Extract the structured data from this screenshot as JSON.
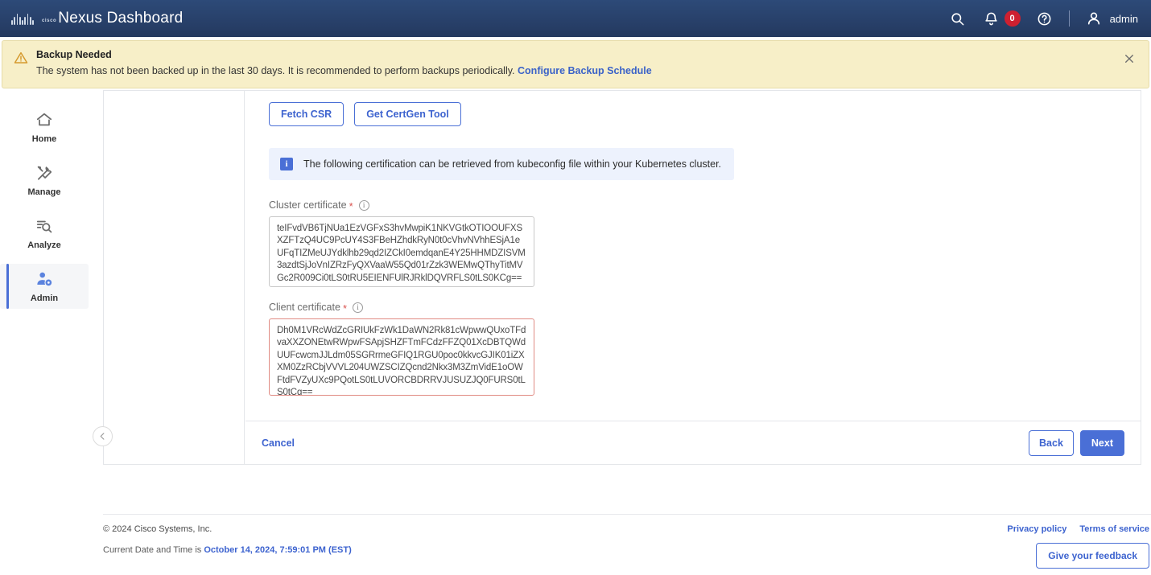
{
  "topbar": {
    "brand_title": "Nexus Dashboard",
    "logo_word": "cisco",
    "search_icon": "search-icon",
    "bell_icon": "bell-icon",
    "notification_count": "0",
    "help_icon": "help-circle-icon",
    "user_icon": "user-avatar-icon",
    "user_name": "admin"
  },
  "banner": {
    "icon": "warning-triangle-icon",
    "title": "Backup Needed",
    "message": "The system has not been backed up in the last 30 days. It is recommended to perform backups periodically.",
    "link_label": "Configure Backup Schedule",
    "close_icon": "close-icon",
    "background_color": "#f7efc8",
    "border_color": "#e6dca8"
  },
  "sidebar": {
    "items": [
      {
        "label": "Home",
        "icon": "home-icon",
        "active": false
      },
      {
        "label": "Manage",
        "icon": "tools-icon",
        "active": false
      },
      {
        "label": "Analyze",
        "icon": "magnifier-lines-icon",
        "active": false
      },
      {
        "label": "Admin",
        "icon": "user-gear-icon",
        "active": true
      }
    ],
    "active_accent_color": "#4a6fd6"
  },
  "main": {
    "buttons": {
      "fetch_csr": "Fetch CSR",
      "get_certgen_tool": "Get CertGen Tool"
    },
    "info_box": {
      "icon": "info-icon",
      "text": "The following certification can be retrieved from kubeconfig file within your Kubernetes cluster.",
      "background_color": "#edf2fd"
    },
    "cluster_certificate": {
      "label": "Cluster certificate",
      "required": "*",
      "info_icon": "info-circle-icon",
      "value": "teIFvdVB6TjNUa1EzVGFxS3hvMwpiK1NKVGtkOTIOOUFXSXZFTzQ4UC9PcUY4S3FBeHZhdkRyN0t0cVhvNVhhESjA1eUFqTIZMeUJYdklhb29qd2IZCkI0emdqanE4Y25HHMDZISVM3azdtSjJoVnIZRzFyQXVaaW55Qd01rZzk3WEMwQThyTitMVGc2R009Ci0tLS0tRU5EIENFUlRJRklDQVRFLS0tLS0KCg==",
      "state": "normal"
    },
    "client_certificate": {
      "label": "Client certificate",
      "required": "*",
      "info_icon": "info-circle-icon",
      "value": "Dh0M1VRcWdZcGRIUkFzWk1DaWN2Rk81cWpwwQUxoTFdvaXXZONEtwRWpwFSApjSHZFTmFCdzFFZQ01XcDBTQWdUUFcwcmJJLdm05SGRrmeGFIQ1RGU0poc0kkvcGJIK01iZXXM0ZzRCbjVVVL204UWZSCIZQcnd2Nkx3M3ZmVidE1oOWFtdFVZyUXc9PQotLS0tLUVORCBDRRVJUSUZJQ0FURS0tLS0tCg==",
      "state": "error"
    },
    "footer": {
      "cancel": "Cancel",
      "back": "Back",
      "next": "Next",
      "collapse_icon": "chevron-left-icon"
    }
  },
  "page_footer": {
    "copyright": "© 2024 Cisco Systems, Inc.",
    "datetime_prefix": "Current Date and Time is",
    "datetime_value": "October 14, 2024, 7:59:01 PM (EST)",
    "privacy_policy": "Privacy policy",
    "terms_of_service": "Terms of service",
    "feedback_button": "Give your feedback"
  }
}
